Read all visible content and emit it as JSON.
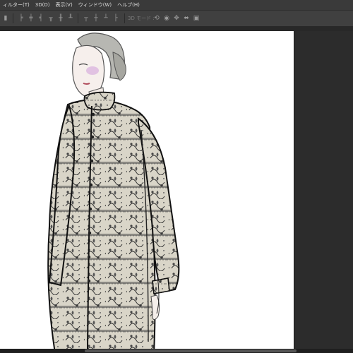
{
  "menu": {
    "items": [
      "ィルター(T)",
      "3D(D)",
      "表示(V)",
      "ウィンドウ(W)",
      "ヘルプ(H)"
    ]
  },
  "options_bar": {
    "mode_3d_label": "3D モード :"
  },
  "colors": {
    "chrome_dark": "#282828",
    "menubar": "#3a3a3a",
    "options_bar": "#404040",
    "canvas": "#ffffff"
  },
  "icons": [
    "align-left-edges-icon",
    "align-hcenter-icon",
    "align-right-edges-icon",
    "align-top-edges-icon",
    "align-vcenter-icon",
    "align-bottom-edges-icon",
    "distribute-icon",
    "3d-rotate-icon",
    "3d-roll-icon",
    "3d-pan-icon",
    "3d-slide-icon",
    "3d-scale-icon"
  ]
}
